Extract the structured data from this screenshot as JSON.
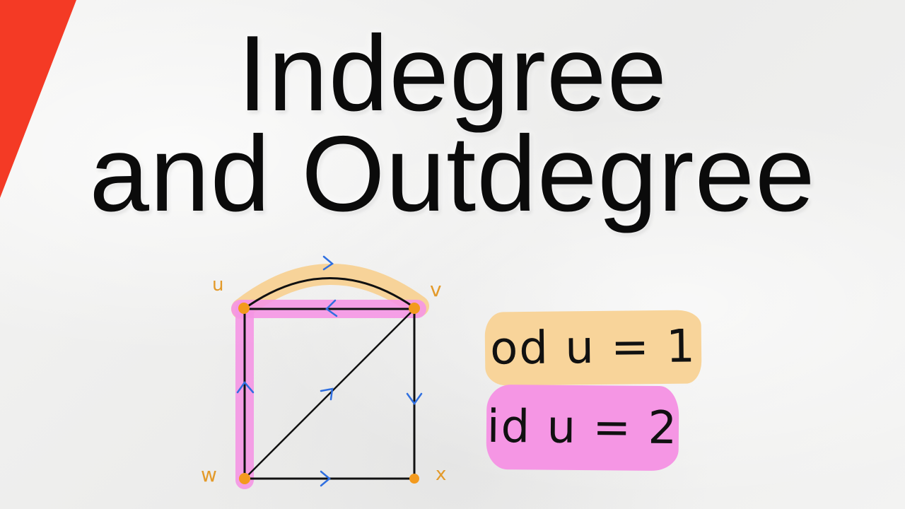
{
  "title": {
    "line1": "Indegree",
    "line2": "and Outdegree"
  },
  "graph": {
    "vertices": {
      "u": "u",
      "v": "v",
      "w": "w",
      "x": "x"
    }
  },
  "formulas": {
    "outdegree": "od u = 1",
    "indegree": "id u = 2"
  },
  "colors": {
    "accent_red": "#f43a25",
    "highlight_orange": "#f8d49a",
    "highlight_pink": "#f596e4",
    "vertex_orange": "#f39a1e",
    "arrow_blue": "#2f6fe0",
    "edge_black": "#111111"
  }
}
